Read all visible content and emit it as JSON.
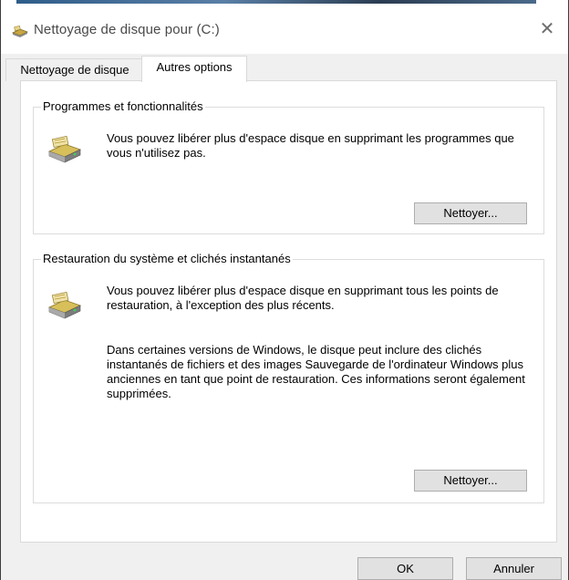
{
  "window": {
    "title": "Nettoyage de disque pour  (C:)",
    "close_icon": "close-icon"
  },
  "tabs": [
    {
      "label": "Nettoyage de disque",
      "active": false
    },
    {
      "label": "Autres options",
      "active": true
    }
  ],
  "groups": {
    "programs": {
      "title": "Programmes et fonctionnalités",
      "description": "Vous pouvez libérer plus d'espace disque en supprimant les programmes que vous n'utilisez pas.",
      "button_label": "Nettoyer...",
      "icon": "drive-cleanup-icon"
    },
    "restore": {
      "title": "Restauration du système et clichés instantanés",
      "description": "Vous pouvez libérer plus d'espace disque en supprimant tous les points de restauration, à l'exception des plus récents.",
      "description2": "Dans certaines versions de Windows, le disque peut inclure des clichés instantanés de fichiers et des images Sauvegarde de l'ordinateur Windows plus anciennes en tant que point de restauration. Ces informations seront également supprimées.",
      "button_label": "Nettoyer...",
      "icon": "drive-cleanup-icon"
    }
  },
  "footer": {
    "ok_label": "OK",
    "cancel_label": "Annuler"
  },
  "colors": {
    "client_bg": "#f0f0f0",
    "button_bg": "#e1e1e1",
    "button_border": "#adadad"
  }
}
